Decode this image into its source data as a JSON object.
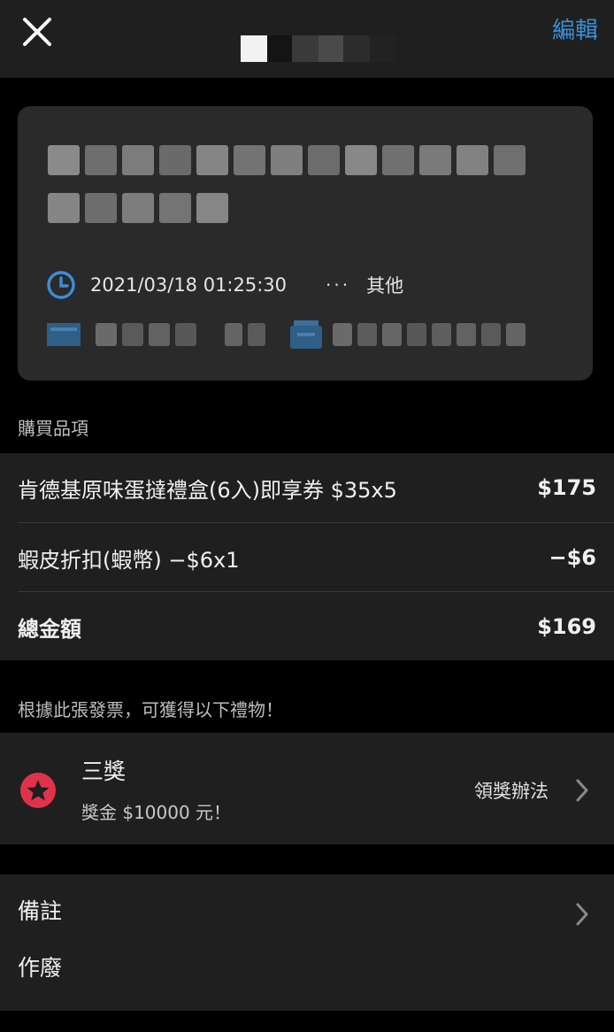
{
  "header": {
    "edit_label": "編輯",
    "close_icon": "close-icon"
  },
  "invoice": {
    "datetime": "2021/03/18 01:25:30",
    "category": "其他",
    "more_icon": "more-dots-icon"
  },
  "purchase": {
    "section_label": "購買品項",
    "items": [
      {
        "name": "肯德基原味蛋撻禮盒(6入)即享券 $35x5",
        "amount": "$175"
      },
      {
        "name": "蝦皮折扣(蝦幣) −$6x1",
        "amount": "−$6"
      }
    ],
    "total_label": "總金額",
    "total_amount": "$169"
  },
  "gifts": {
    "section_label": "根據此張發票，可獲得以下禮物！",
    "prize_title": "三獎",
    "prize_desc": "獎金 $10000 元！",
    "claim_label": "領獎辦法"
  },
  "notes": {
    "remark_label": "備註",
    "void_label": "作廢"
  },
  "colors": {
    "accent": "#3a8fd6",
    "prize_badge": "#e0334a",
    "background": "#000000",
    "surface": "#1f1f1f",
    "card": "#2a2a2a"
  }
}
